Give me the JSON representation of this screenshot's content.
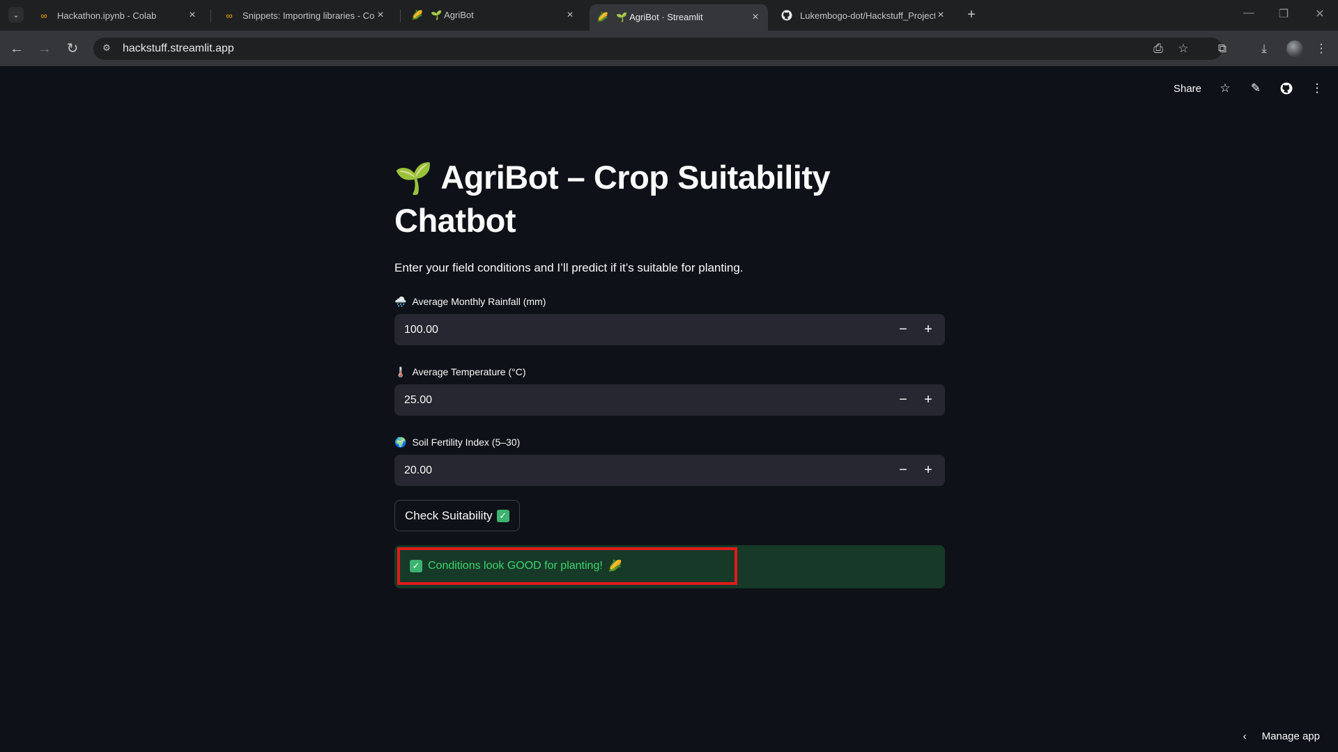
{
  "browser": {
    "tabs": [
      {
        "title": "Hackathon.ipynb - Colab",
        "icon": "colab-icon"
      },
      {
        "title": "Snippets: Importing libraries - Cola",
        "icon": "colab-icon"
      },
      {
        "title": "🌱 AgriBot",
        "icon": "corn-icon"
      },
      {
        "title": "🌱 AgriBot · Streamlit",
        "icon": "corn-icon",
        "active": true
      },
      {
        "title": "Lukembogo-dot/Hackstuff_Project",
        "icon": "github-icon"
      }
    ],
    "url": "hackstuff.streamlit.app"
  },
  "app": {
    "share_label": "Share",
    "title_emoji": "🌱",
    "title": "AgriBot – Crop Suitability Chatbot",
    "description": "Enter your field conditions and I’ll predict if it’s suitable for planting.",
    "fields": [
      {
        "emoji": "🌧️",
        "label": "Average Monthly Rainfall (mm)",
        "value": "100.00"
      },
      {
        "emoji": "🌡️",
        "label": "Average Temperature (°C)",
        "value": "25.00"
      },
      {
        "emoji": "🌍",
        "label": "Soil Fertility Index (5–30)",
        "value": "20.00"
      }
    ],
    "check_button": "Check Suitability",
    "result": "Conditions look GOOD for planting!",
    "result_emoji": "🌽",
    "manage_label": "Manage app"
  },
  "colors": {
    "background": "#0e1117",
    "input_bg": "#262730",
    "success_bg": "#173928",
    "success_text": "#3dd56d",
    "highlight": "#e01b1b"
  }
}
